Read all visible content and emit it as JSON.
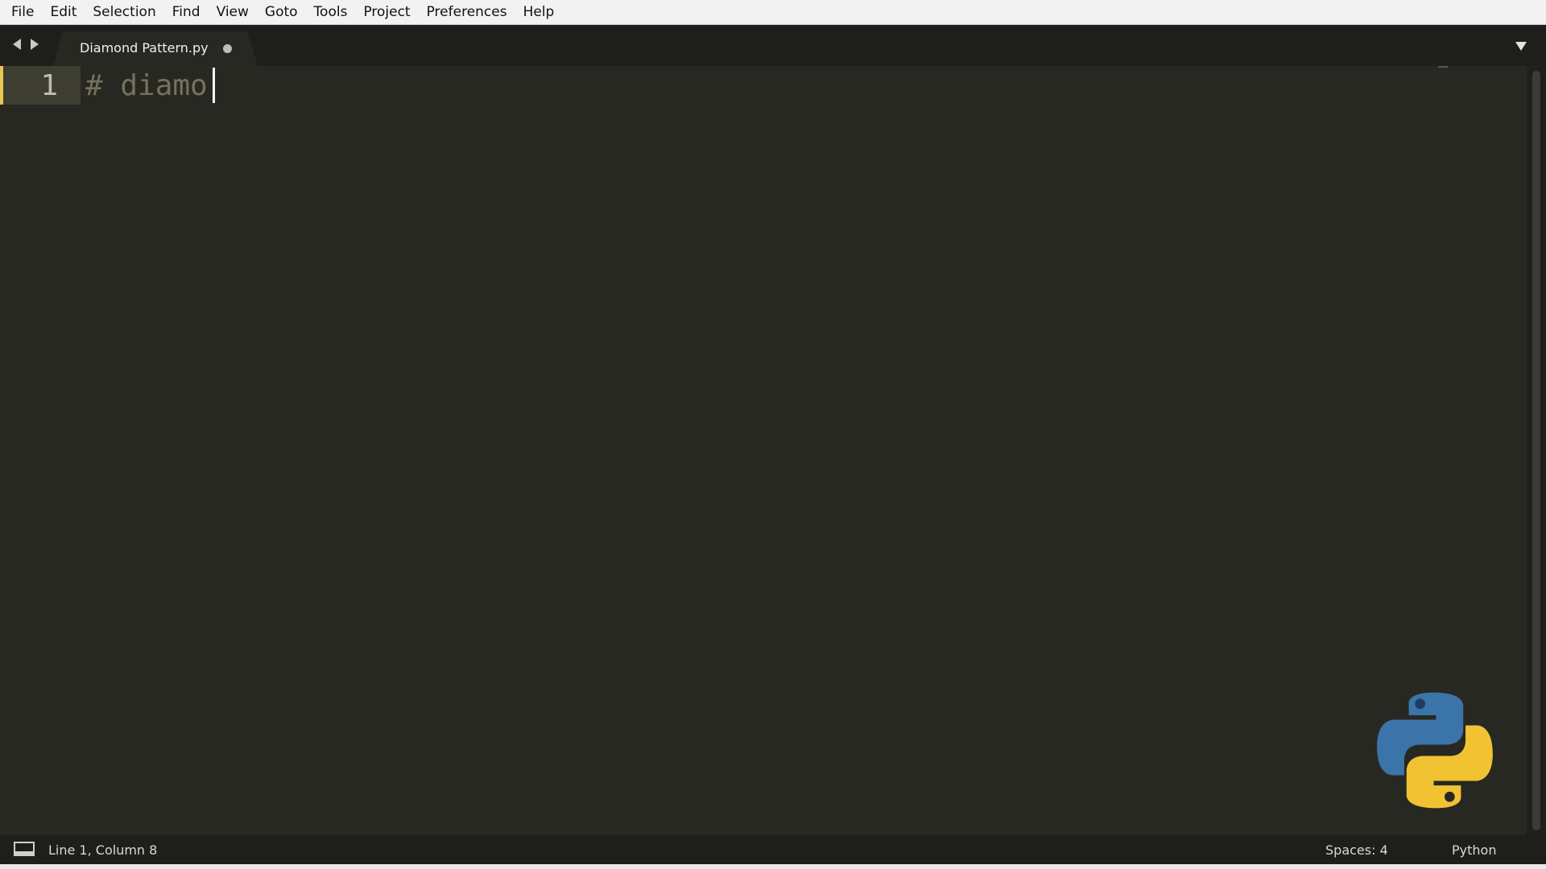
{
  "menubar": {
    "items": [
      "File",
      "Edit",
      "Selection",
      "Find",
      "View",
      "Goto",
      "Tools",
      "Project",
      "Preferences",
      "Help"
    ]
  },
  "tabbar": {
    "active_tab": {
      "label": "Diamond Pattern.py",
      "unsaved": true
    },
    "icons": [
      "chevron-left-icon",
      "chevron-right-icon",
      "dropdown-arrow-icon"
    ]
  },
  "editor": {
    "lines": [
      {
        "number": "1",
        "text": "# diamo"
      }
    ],
    "colors": {
      "background": "#272822",
      "comment": "#75715e",
      "modified_marker": "#e6c84f"
    }
  },
  "statusbar": {
    "position": "Line 1, Column 8",
    "indentation": "Spaces: 4",
    "syntax": "Python"
  },
  "overlay": {
    "logo": "python-logo",
    "logo_colors": [
      "#3b74a8",
      "#f1c232"
    ]
  }
}
